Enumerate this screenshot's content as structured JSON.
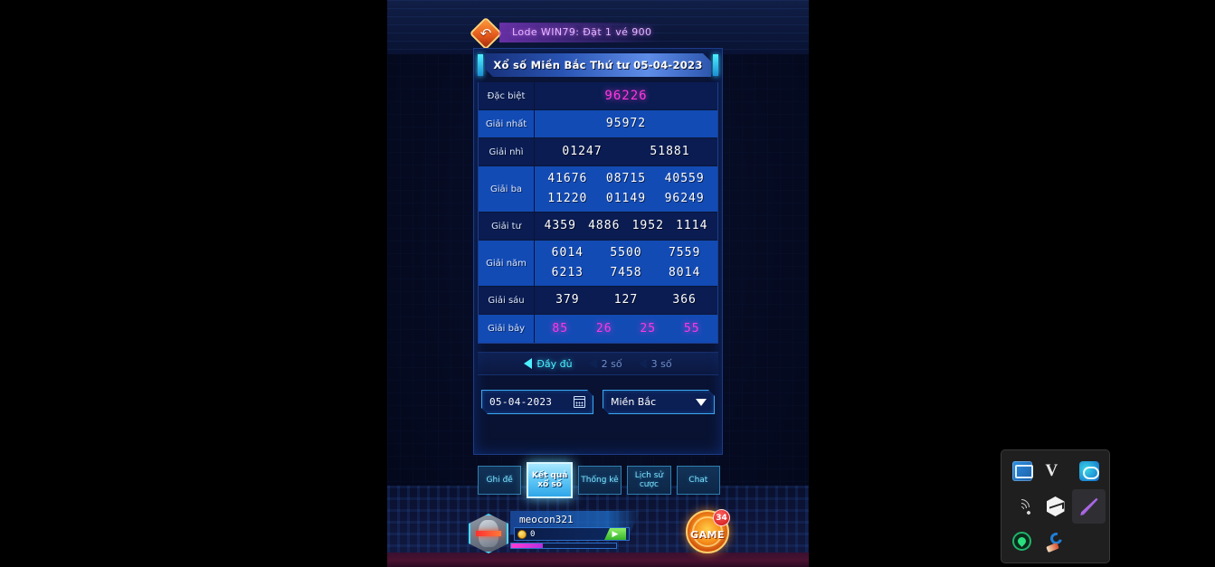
{
  "breadcrumb": {
    "back_icon": "back-arrow-icon",
    "text": "Lode WIN79: Đặt 1 vé 900"
  },
  "panel": {
    "title": "Xổ số Miền Bắc Thứ tư 05-04-2023",
    "accent_cyan": "#4df0ff",
    "accent_magenta": "#ff38e0",
    "row_dark": "#0a1c52",
    "row_light": "#134bb5"
  },
  "prizes": [
    {
      "label": "Đặc biệt",
      "values": [
        "96226"
      ],
      "cols": 1,
      "style": "special",
      "shade": "dark"
    },
    {
      "label": "Giải nhất",
      "values": [
        "95972"
      ],
      "cols": 1,
      "style": "normal",
      "shade": "light"
    },
    {
      "label": "Giải nhì",
      "values": [
        "01247",
        "51881"
      ],
      "cols": 2,
      "style": "normal",
      "shade": "dark"
    },
    {
      "label": "Giải ba",
      "values": [
        "41676",
        "08715",
        "40559",
        "11220",
        "01149",
        "96249"
      ],
      "cols": 3,
      "style": "normal",
      "shade": "light"
    },
    {
      "label": "Giải tư",
      "values": [
        "4359",
        "4886",
        "1952",
        "1114"
      ],
      "cols": 4,
      "style": "normal",
      "shade": "dark"
    },
    {
      "label": "Giải năm",
      "values": [
        "6014",
        "5500",
        "7559",
        "6213",
        "7458",
        "8014"
      ],
      "cols": 3,
      "style": "normal",
      "shade": "light"
    },
    {
      "label": "Giải sáu",
      "values": [
        "379",
        "127",
        "366"
      ],
      "cols": 3,
      "style": "normal",
      "shade": "dark"
    },
    {
      "label": "Giải bảy",
      "values": [
        "85",
        "26",
        "25",
        "55"
      ],
      "cols": 4,
      "style": "seven",
      "shade": "light"
    }
  ],
  "digit_filter": {
    "options": [
      {
        "label": "Đầy đủ",
        "active": true
      },
      {
        "label": "2 số",
        "active": false
      },
      {
        "label": "3 số",
        "active": false
      }
    ]
  },
  "controls": {
    "date_value": "05-04-2023",
    "date_icon": "calendar-icon",
    "region_value": "Miền Bắc",
    "region_icon": "chevron-down-icon"
  },
  "bottom_nav": [
    {
      "label": "Ghi đề",
      "active": false
    },
    {
      "label": "Kết quả xổ số",
      "active": true
    },
    {
      "label": "Thống kê",
      "active": false
    },
    {
      "label": "Lịch sử cược",
      "active": false
    },
    {
      "label": "Chat",
      "active": false
    }
  ],
  "player": {
    "name": "meocon321",
    "coin_amount": "0",
    "coin_icon": "coin-icon",
    "add_icon": "add-coin-icon",
    "avatar_icon": "player-avatar"
  },
  "game_badge": {
    "label": "GAME",
    "count": "34"
  },
  "tray": {
    "icons": [
      {
        "name": "network-icon",
        "kind": "network",
        "selected": false
      },
      {
        "name": "vmware-icon",
        "kind": "v",
        "selected": false
      },
      {
        "name": "teams-icon",
        "kind": "teams",
        "selected": false
      },
      {
        "name": "wifi-icon",
        "kind": "wifi",
        "selected": false
      },
      {
        "name": "hexagon-app-icon",
        "kind": "hex",
        "selected": false
      },
      {
        "name": "feather-icon",
        "kind": "feather",
        "selected": true
      },
      {
        "name": "globe-icon",
        "kind": "globe",
        "selected": false
      },
      {
        "name": "ccleaner-icon",
        "kind": "ccleaner",
        "selected": false
      }
    ]
  }
}
